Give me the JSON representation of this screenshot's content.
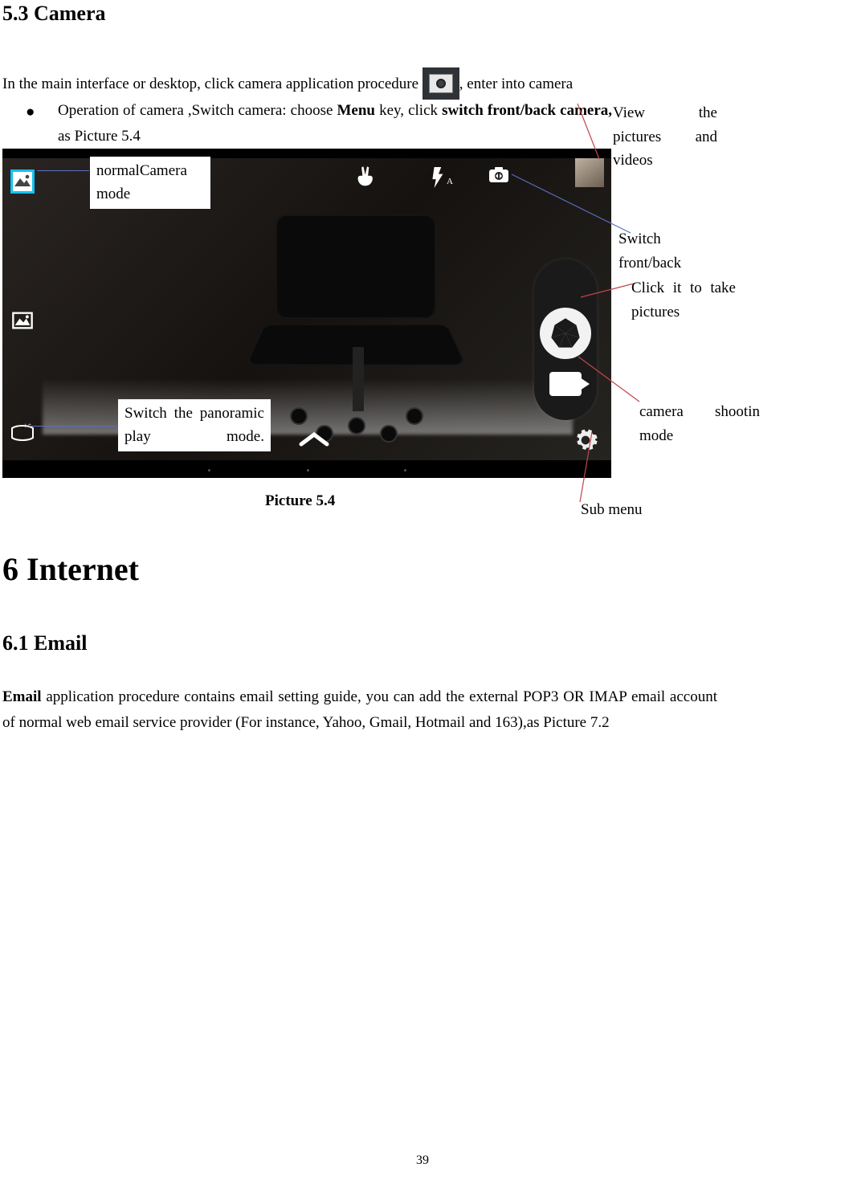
{
  "section_5_3_title": "5.3 Camera",
  "intro_pre": "In the main interface or desktop, click camera application procedure",
  "intro_post": ",  enter into camera",
  "bullet": "●",
  "bullet_line1": "Operation  of  camera  ,Switch  camera:  choose  ",
  "bullet_menu": "Menu",
  "bullet_line1b": "  key,  click  ",
  "bullet_bold2": "switch  front/back camera,",
  "bullet_line2": " as Picture 5.4",
  "label_normal_camera": "normalCamera mode",
  "label_panoramic": "Switch  the  panoramic play mode.",
  "figure_caption": "Picture 5.4",
  "callout_view": "View the pictures and videos",
  "callout_switch_fb": "Switch front/back",
  "callout_take_pic": "Click it to take pictures",
  "callout_shoot_mode": "camera   shootin mode",
  "callout_submenu": "Sub menu",
  "section_6_title": "6 Internet",
  "section_6_1_title": "6.1 Email",
  "email_para": "Email application procedure contains email setting guide, you can add the external POP3 OR IMAP email account of normal web email service provider (For instance, Yahoo, Gmail, Hotmail and 163),as Picture 7.2",
  "email_bold": "Email",
  "page_number": "39"
}
